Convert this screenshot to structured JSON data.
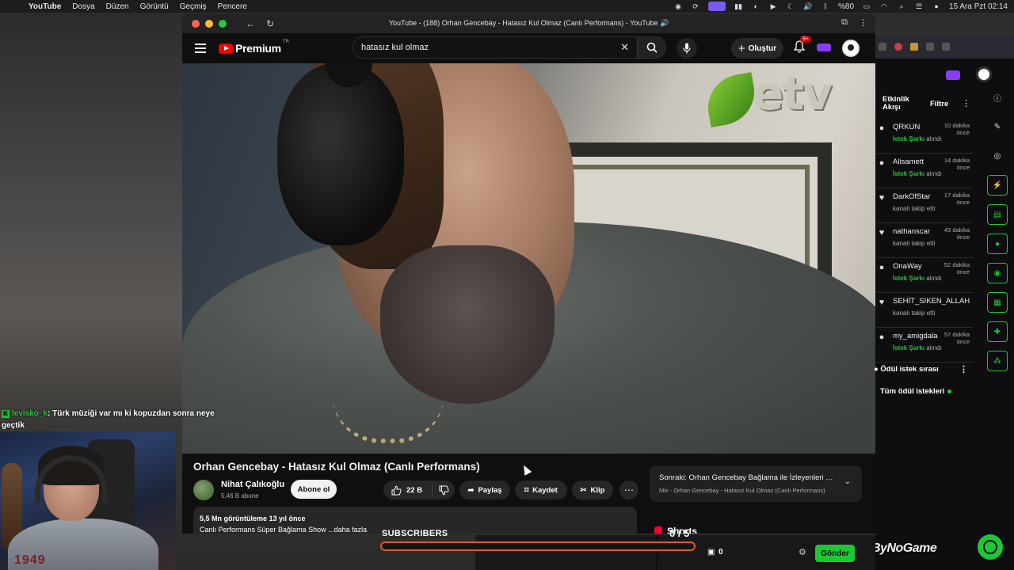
{
  "menubar": {
    "app": "YouTube",
    "items": [
      "Dosya",
      "Düzen",
      "Görüntü",
      "Geçmiş",
      "Pencere"
    ],
    "battery": "%80",
    "datetime": "15 Ara Pzt 02:14"
  },
  "browser": {
    "window_title": "YouTube - (188) Orhan Gencebay - Hatasız Kul Olmaz (Canlı Performans) - YouTube 🔊"
  },
  "youtube": {
    "logo_text": "Premium",
    "logo_region": "TR",
    "search_value": "hatasız kul olmaz",
    "create_label": "Oluştur",
    "notif_badge": "9+",
    "video_watermark": "etv",
    "video_title": "Orhan Gencebay - Hatasız Kul Olmaz (Canlı Performans)",
    "channel_name": "Nihat Çalıkoğlu",
    "channel_subs": "5,46 B abone",
    "subscribe_label": "Abone ol",
    "like_count": "22 B",
    "share_label": "Paylaş",
    "save_label": "Kaydet",
    "clip_label": "Klip",
    "next_title": "Sonraki: Orhan Gencebay Bağlama ile İzleyenleri Bü...",
    "next_sub": "Mix - Orhan Gencebay - Hatasız Kul Olmaz (Canlı Performans)",
    "views_line": "5,5 Mn görüntüleme  13 yıl önce",
    "desc_line": "Canlı Performans Süper Bağlama Show ...daha fazla",
    "shorts_label": "Shorts"
  },
  "activity": {
    "title": "Etkinlik Akışı",
    "filter_label": "Filtre",
    "events": [
      {
        "user": "QRKUN",
        "time": "10 dakika önce",
        "highlight": "İstek Şarkı",
        "action": "alındı",
        "icon": "gift"
      },
      {
        "user": "Alisamett",
        "time": "14 dakika önce",
        "highlight": "İstek Şarkı",
        "action": "alındı",
        "icon": "gift"
      },
      {
        "user": "DarkOfStar",
        "time": "17 dakika önce",
        "highlight": "",
        "action": "kanalı takip etti",
        "icon": "heart"
      },
      {
        "user": "nathanscar",
        "time": "43 dakika önce",
        "highlight": "",
        "action": "kanalı takip etti",
        "icon": "heart"
      },
      {
        "user": "OnaWay",
        "time": "52 dakika önce",
        "highlight": "İstek Şarkı",
        "action": "alındı",
        "icon": "gift"
      },
      {
        "user": "SEHİT_SIKEN_ALLAH",
        "time": "",
        "highlight": "",
        "action": "kanalı takip etti",
        "icon": "heart"
      },
      {
        "user": "my_amigdala",
        "time": "57 dakika önce",
        "highlight": "İstek Şarkı",
        "action": "alındı",
        "icon": "gift"
      }
    ]
  },
  "rewards": {
    "title": "Ödül istek sırası",
    "all_label": "Tüm ödül istekleri"
  },
  "bottom": {
    "gift_count": "0",
    "send_label": "Gönder",
    "brand": "ByNoGame"
  },
  "overlay": {
    "subscribers_label": "SUBSCRIBERS",
    "subscribers_count": "0 / 5",
    "subscribers_progress": 0.0,
    "chat_user": "levisko_k",
    "chat_message": ": Türk müziği var mı ki kopuzdan sonra neye geçtik",
    "webcam_text": "1949"
  },
  "colors": {
    "yt_red": "#ff0000",
    "kick_green": "#1ec734",
    "subs_orange": "#e8542a",
    "twitch_purple": "#8a3cf5"
  }
}
